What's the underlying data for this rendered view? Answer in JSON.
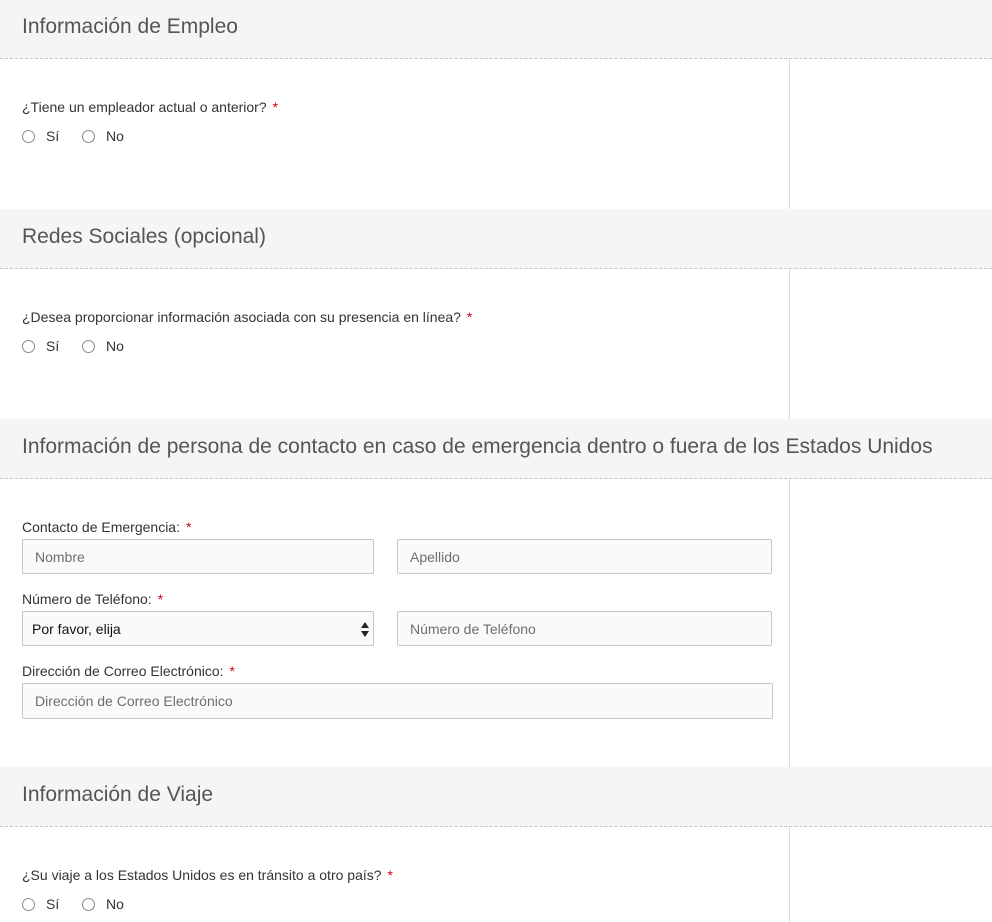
{
  "sections": {
    "employment": {
      "title": "Información de Empleo",
      "question": "¿Tiene un empleador actual o anterior?",
      "required": "*",
      "yes_label": "Sí",
      "no_label": "No"
    },
    "social": {
      "title": "Redes Sociales (opcional)",
      "question": "¿Desea proporcionar información asociada con su presencia en línea?",
      "required": "*",
      "yes_label": "Sí",
      "no_label": "No"
    },
    "emergency": {
      "title": "Información de persona de contacto en caso de emergencia dentro o fuera de los Estados Unidos",
      "contact_label": "Contacto de Emergencia:",
      "first_name_placeholder": "Nombre",
      "last_name_placeholder": "Apellido",
      "phone_label": "Número de Teléfono:",
      "country_code_selected": "Por favor, elija",
      "phone_placeholder": "Número de Teléfono",
      "email_label": "Dirección de Correo Electrónico:",
      "email_placeholder": "Dirección de Correo Electrónico",
      "required": "*"
    },
    "travel": {
      "title": "Información de Viaje",
      "question": "¿Su viaje a los Estados Unidos es en tránsito a otro país?",
      "required": "*",
      "yes_label": "Sí",
      "no_label": "No"
    }
  },
  "colors": {
    "header_bg": "#f5f5f5",
    "required": "#d0021b",
    "text": "#333333",
    "heading": "#555555"
  }
}
